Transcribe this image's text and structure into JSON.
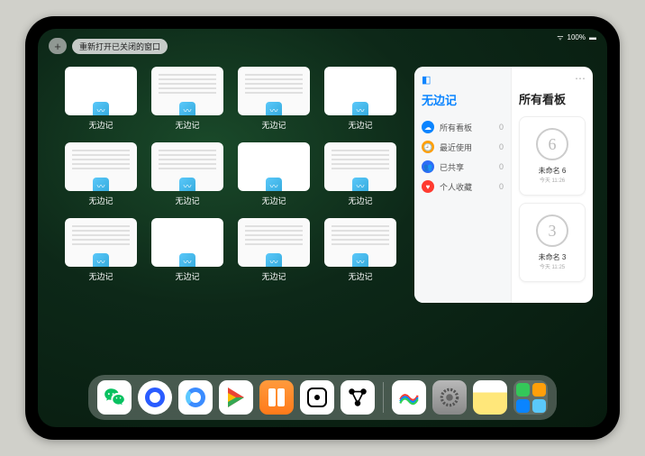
{
  "status": {
    "battery": "100%"
  },
  "top": {
    "plus_label": "+",
    "reopen_label": "重新打开已关闭的窗口"
  },
  "windows": {
    "app_label": "无边记",
    "items": [
      {
        "type": "blank"
      },
      {
        "type": "doc"
      },
      {
        "type": "doc"
      },
      {
        "type": "blank"
      },
      {
        "type": "doc"
      },
      {
        "type": "doc"
      },
      {
        "type": "blank"
      },
      {
        "type": "doc"
      },
      {
        "type": "doc"
      },
      {
        "type": "blank"
      },
      {
        "type": "doc"
      },
      {
        "type": "doc"
      }
    ]
  },
  "panel": {
    "left_title": "无边记",
    "right_title": "所有看板",
    "categories": [
      {
        "icon_color": "#0a84ff",
        "glyph": "☁",
        "label": "所有看板",
        "count": 0
      },
      {
        "icon_color": "#ff9f0a",
        "glyph": "🕘",
        "label": "最近使用",
        "count": 0
      },
      {
        "icon_color": "#2d6cf6",
        "glyph": "👥",
        "label": "已共享",
        "count": 0
      },
      {
        "icon_color": "#ff3b30",
        "glyph": "♥",
        "label": "个人收藏",
        "count": 0
      }
    ],
    "boards": [
      {
        "sketch": "6",
        "name": "未命名 6",
        "date": "今天 11:26"
      },
      {
        "sketch": "3",
        "name": "未命名 3",
        "date": "今天 11:25"
      }
    ]
  },
  "dock": {
    "apps": [
      {
        "name": "wechat"
      },
      {
        "name": "quark"
      },
      {
        "name": "tencent-video"
      },
      {
        "name": "google-play"
      },
      {
        "name": "books"
      },
      {
        "name": "dice"
      },
      {
        "name": "routes"
      },
      {
        "name": "freeform"
      },
      {
        "name": "settings"
      },
      {
        "name": "notes"
      },
      {
        "name": "app-library"
      }
    ]
  }
}
